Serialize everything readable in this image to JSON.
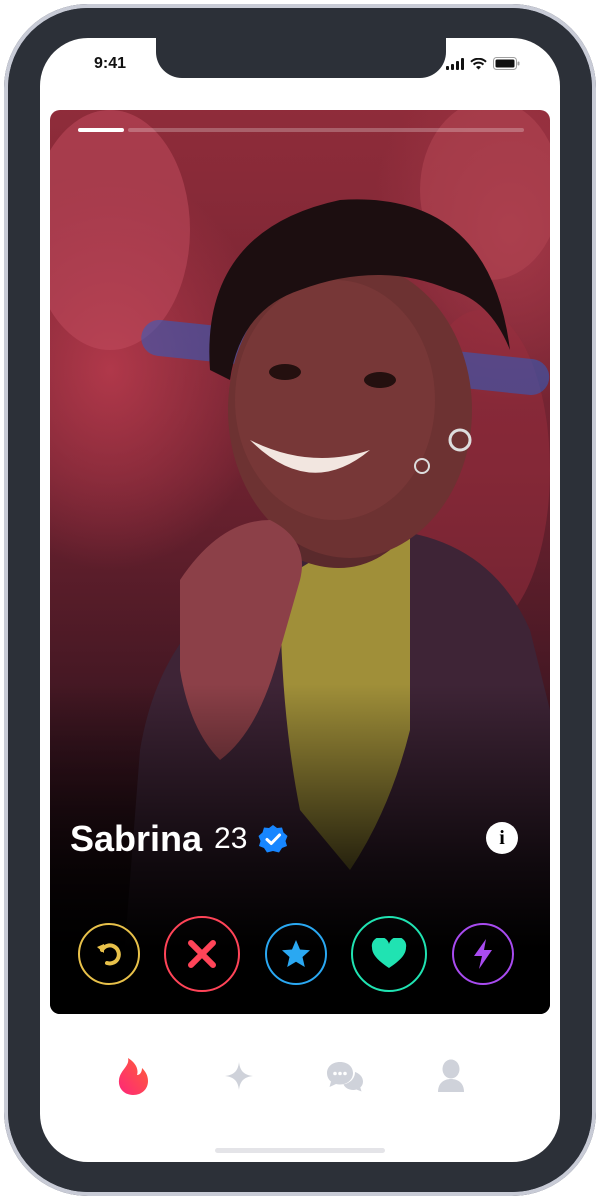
{
  "status_bar": {
    "time": "9:41"
  },
  "profile": {
    "name": "Sabrina",
    "age": "23",
    "verified": true
  },
  "info_icon": "i",
  "photo_progress": {
    "current": 1,
    "total": 10
  },
  "actions": [
    {
      "name": "rewind-button",
      "icon": "rewind-icon",
      "color": "#e8c14a"
    },
    {
      "name": "nope-button",
      "icon": "close-icon",
      "color": "#ff4458"
    },
    {
      "name": "super-like-button",
      "icon": "star-icon",
      "color": "#2aa8f2"
    },
    {
      "name": "like-button",
      "icon": "heart-icon",
      "color": "#20e3b2"
    },
    {
      "name": "boost-button",
      "icon": "lightning-icon",
      "color": "#a84bf0"
    }
  ],
  "tabs": [
    {
      "name": "tab-discover",
      "icon": "flame-icon",
      "active": true
    },
    {
      "name": "tab-explore",
      "icon": "sparkle-icon",
      "active": false
    },
    {
      "name": "tab-messages",
      "icon": "chat-icon",
      "active": false
    },
    {
      "name": "tab-profile",
      "icon": "user-icon",
      "active": false
    }
  ],
  "colors": {
    "accent": "#fd5068",
    "frame": "#2e3240",
    "inactive_tab": "#cfd2da",
    "verified": "#1786ff"
  }
}
